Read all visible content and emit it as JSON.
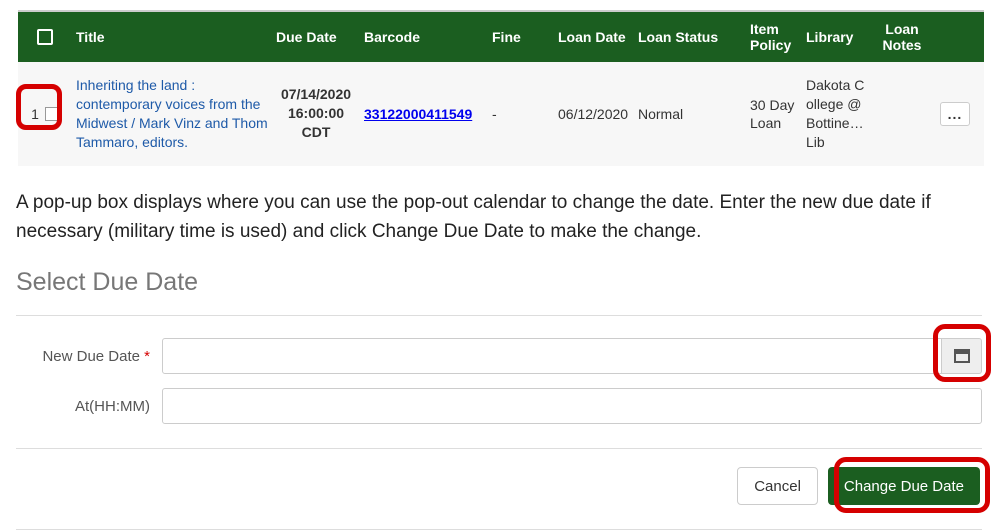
{
  "table": {
    "headers": {
      "title": "Title",
      "due_date": "Due Date",
      "barcode": "Barcode",
      "fine": "Fine",
      "loan_date": "Loan Date",
      "loan_status": "Loan Status",
      "item_policy": "Item Policy",
      "library": "Library",
      "loan_notes": "Loan Notes"
    },
    "rows": [
      {
        "index": "1",
        "title": "Inheriting the land : contemporary voices from the Midwest / Mark Vinz and Thom Tammaro, editors.",
        "due_date": "07/14/2020 16:00:00 CDT",
        "barcode": "33122000411549",
        "fine": "-",
        "loan_date": "06/12/2020",
        "loan_status": "Normal",
        "item_policy": "30 Day Loan",
        "library": "Dakota College @ Bottine… Lib",
        "loan_notes": ""
      }
    ]
  },
  "instruction_text": "A pop-up box displays where you can use the pop-out calendar to change the date. Enter the new due date if necessary (military time is used) and click Change Due Date to make the change.",
  "dialog": {
    "title": "Select Due Date",
    "fields": {
      "new_due_date_label": "New Due Date",
      "at_label": "At(HH:MM)",
      "new_due_date_value": "",
      "at_value": ""
    },
    "buttons": {
      "cancel": "Cancel",
      "submit": "Change Due Date"
    }
  },
  "icons": {
    "calendar": "calendar-icon",
    "more": "..."
  }
}
